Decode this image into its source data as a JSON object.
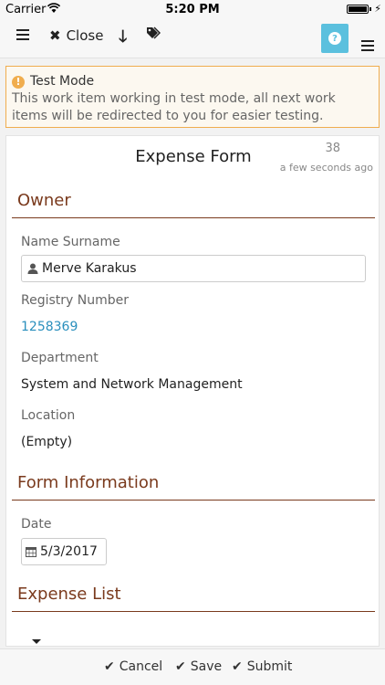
{
  "status_bar": {
    "carrier": "Carrier",
    "time": "5:20 PM",
    "icons": [
      "wifi-icon",
      "battery-icon",
      "charging-bolt-icon"
    ]
  },
  "toolbar": {
    "menu_icon": "hamburger-icon",
    "close_label": "Close",
    "close_icon": "close-x-icon",
    "down_icon": "arrow-down-icon",
    "tag_icon": "tags-icon",
    "help_icon": "question-circle-icon",
    "more_icon": "hamburger-icon"
  },
  "alert": {
    "icon": "warning-circle-icon",
    "title": "Test Mode",
    "message": "This work item working in test mode, all next work items will be redirected to you for easier testing."
  },
  "form": {
    "title": "Expense Form",
    "number": "38",
    "timestamp": "a few seconds ago",
    "owner": {
      "heading": "Owner",
      "name_label": "Name Surname",
      "name_value": "Merve Karakus",
      "registry_label": "Registry Number",
      "registry_value": "1258369",
      "department_label": "Department",
      "department_value": "System and Network Management",
      "location_label": "Location",
      "location_value": "(Empty)"
    },
    "form_information": {
      "heading": "Form Information",
      "date_label": "Date",
      "date_value": "5/3/2017"
    },
    "expense_list": {
      "heading": "Expense List"
    }
  },
  "bottom_bar": {
    "cancel_label": "Cancel",
    "save_label": "Save",
    "submit_label": "Submit"
  },
  "colors": {
    "accent_section": "#7a3a1d",
    "help_button": "#5bc0de",
    "alert_border": "#f0ad4e",
    "link": "#2a8fbd"
  }
}
